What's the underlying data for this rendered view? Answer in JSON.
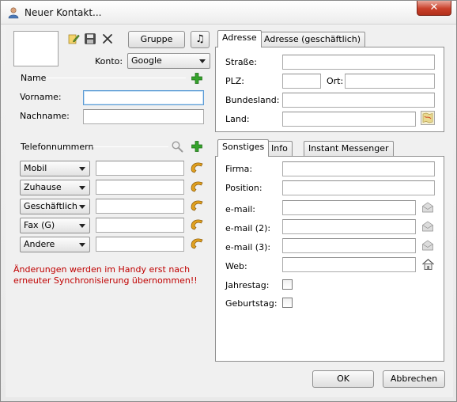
{
  "window": {
    "title": "Neuer Kontakt...",
    "close_label": "✕"
  },
  "toolbar": {
    "gruppe_label": "Gruppe",
    "music_glyph": "♫"
  },
  "account": {
    "label": "Konto:",
    "value": "Google"
  },
  "name_section": {
    "title": "Name",
    "vorname_label": "Vorname:",
    "nachname_label": "Nachname:"
  },
  "phone_section": {
    "title": "Telefonnummern",
    "rows": [
      {
        "type": "Mobil"
      },
      {
        "type": "Zuhause"
      },
      {
        "type": "Geschäftlich"
      },
      {
        "type": "Fax (G)"
      },
      {
        "type": "Andere"
      }
    ]
  },
  "warning": {
    "line1": "Änderungen werden im Handy erst nach",
    "line2": "erneuter Synchronisierung übernommen!!"
  },
  "address_tabs": {
    "tab1": "Adresse",
    "tab2": "Adresse (geschäftlich)"
  },
  "address": {
    "strasse_label": "Straße:",
    "plz_label": "PLZ:",
    "ort_label": "Ort:",
    "bundesland_label": "Bundesland:",
    "land_label": "Land:"
  },
  "other_tabs": {
    "tab1": "Sonstiges",
    "tab2": "Info",
    "tab3": "Instant Messenger"
  },
  "other": {
    "firma_label": "Firma:",
    "position_label": "Position:",
    "email1_label": "e-mail:",
    "email2_label": "e-mail (2):",
    "email3_label": "e-mail (3):",
    "web_label": "Web:",
    "jahrestag_label": "Jahrestag:",
    "geburtstag_label": "Geburtstag:"
  },
  "buttons": {
    "ok": "OK",
    "cancel": "Abbrechen"
  }
}
